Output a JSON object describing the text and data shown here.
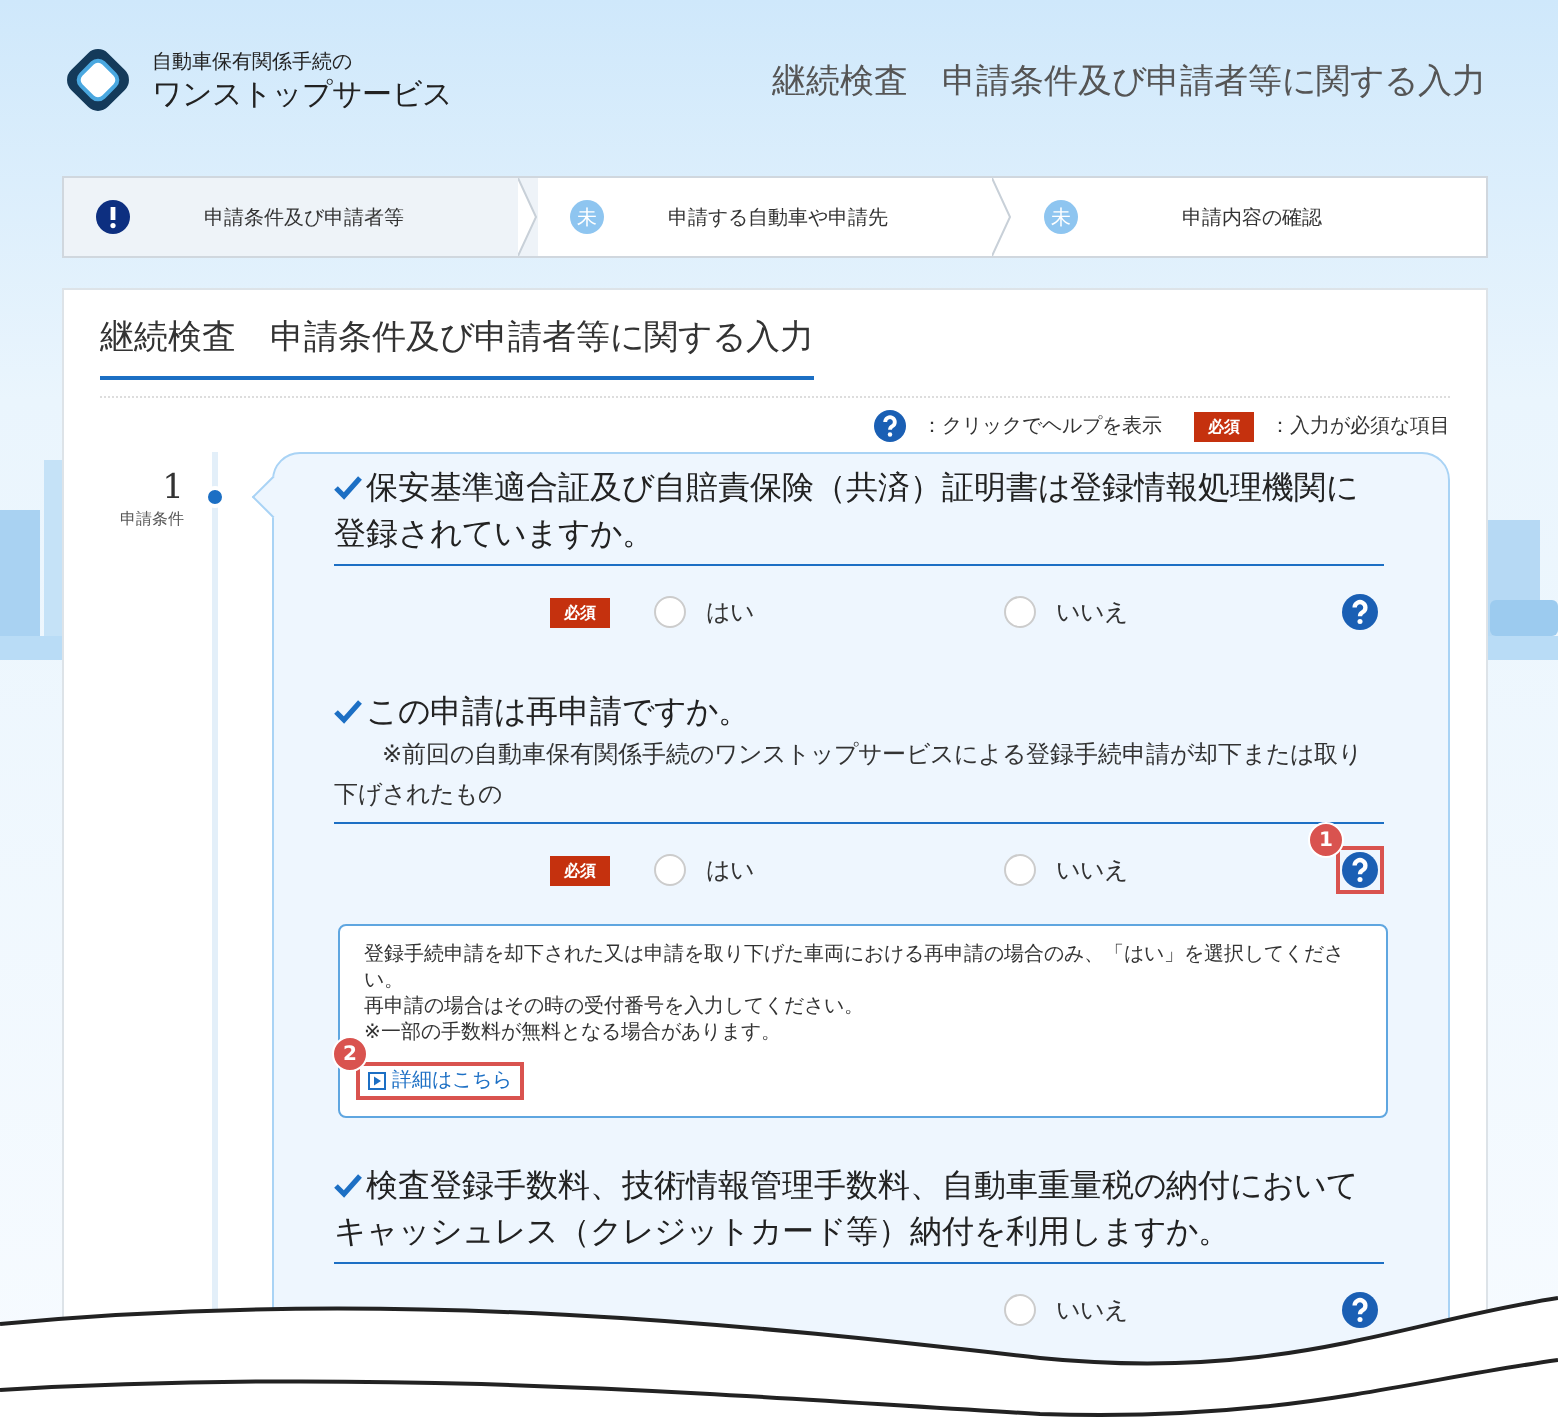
{
  "header": {
    "logo_subtitle": "自動車保有関係手続の",
    "logo_title": "ワンストップサービス",
    "page_title": "継続検査　申請条件及び申請者等に関する入力"
  },
  "steps": [
    {
      "label": "申請条件及び申請者等",
      "kind": "current",
      "selected": true
    },
    {
      "label": "申請する自動車や申請先",
      "kind": "pending",
      "badge": "未",
      "selected": false
    },
    {
      "label": "申請内容の確認",
      "kind": "pending",
      "badge": "未",
      "selected": false
    }
  ],
  "panel": {
    "title": "継続検査　申請条件及び申請者等に関する入力",
    "legend": {
      "help_text": "：クリックでヘルプを表示",
      "required_badge": "必須",
      "required_text": "：入力が必須な項目"
    }
  },
  "sidebar": {
    "number": "1",
    "label": "申請条件"
  },
  "questions": [
    {
      "title": "保安基準適合証及び自賠責保険（共済）証明書は登録情報処理機関に登録されていますか。",
      "required_badge": "必須",
      "options": [
        {
          "label": "はい",
          "selected": false
        },
        {
          "label": "いいえ",
          "selected": false
        }
      ]
    },
    {
      "title": "この申請は再申請ですか。",
      "note": "※前回の自動車保有関係手続のワンストップサービスによる登録手続申請が却下または取り下げされたもの",
      "required_badge": "必須",
      "options": [
        {
          "label": "はい",
          "selected": false
        },
        {
          "label": "いいえ",
          "selected": false
        }
      ],
      "help_callout": "1",
      "help": {
        "lines": [
          "登録手続申請を却下された又は申請を取り下げた車両における再申請の場合のみ、「はい」を選択してください。",
          "再申請の場合はその時の受付番号を入力してください。",
          "※一部の手数料が無料となる場合があります。"
        ],
        "link": "詳細はこちら",
        "link_callout": "2"
      }
    },
    {
      "title": "検査登録手数料、技術情報管理手数料、自動車重量税の納付においてキャッシュレス（クレジットカード等）納付を利用しますか。",
      "options": [
        {
          "label": "いいえ",
          "selected": false
        }
      ]
    }
  ]
}
